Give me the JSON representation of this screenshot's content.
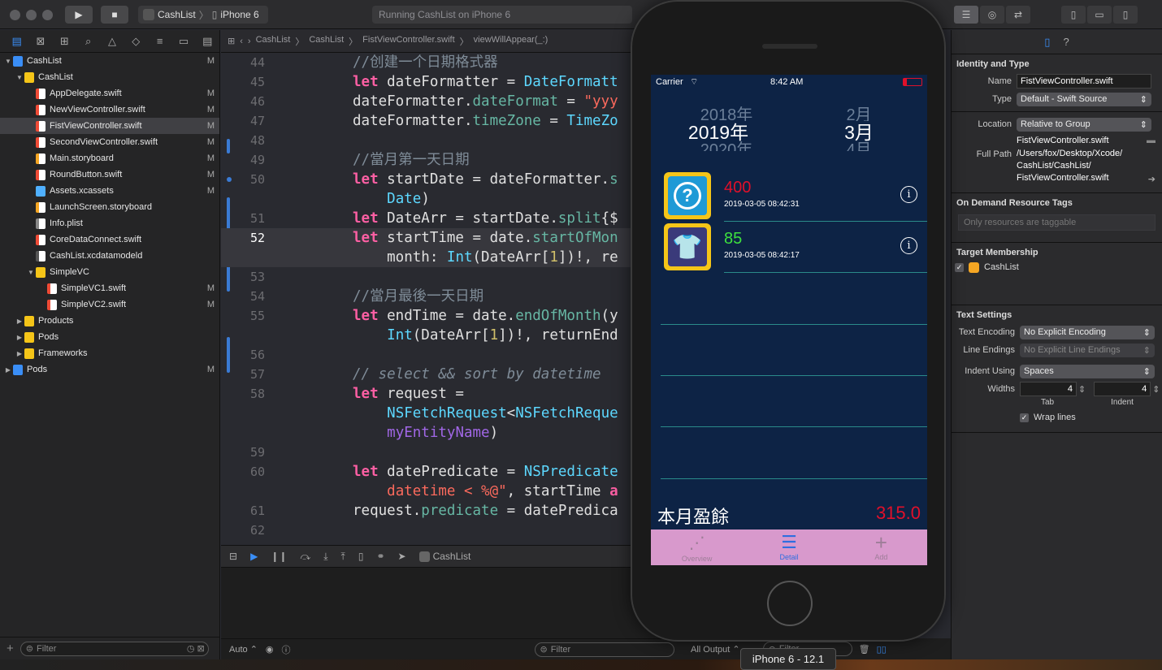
{
  "toolbar": {
    "scheme_project": "CashList",
    "scheme_device": "iPhone 6",
    "status": "Running CashList on iPhone 6"
  },
  "navigator": {
    "tree": [
      {
        "label": "CashList",
        "indent": 0,
        "icon": "project",
        "disclosure": "open",
        "badge": "M"
      },
      {
        "label": "CashList",
        "indent": 1,
        "icon": "folder",
        "disclosure": "open",
        "badge": ""
      },
      {
        "label": "AppDelegate.swift",
        "indent": 2,
        "icon": "swift",
        "disclosure": "",
        "badge": "M"
      },
      {
        "label": "NewViewController.swift",
        "indent": 2,
        "icon": "swift",
        "disclosure": "",
        "badge": "M"
      },
      {
        "label": "FistViewController.swift",
        "indent": 2,
        "icon": "swift",
        "disclosure": "",
        "badge": "M",
        "selected": true
      },
      {
        "label": "SecondViewController.swift",
        "indent": 2,
        "icon": "swift",
        "disclosure": "",
        "badge": "M"
      },
      {
        "label": "Main.storyboard",
        "indent": 2,
        "icon": "storyboard",
        "disclosure": "",
        "badge": "M"
      },
      {
        "label": "RoundButton.swift",
        "indent": 2,
        "icon": "swift",
        "disclosure": "",
        "badge": "M"
      },
      {
        "label": "Assets.xcassets",
        "indent": 2,
        "icon": "assets",
        "disclosure": "",
        "badge": "M"
      },
      {
        "label": "LaunchScreen.storyboard",
        "indent": 2,
        "icon": "storyboard",
        "disclosure": "",
        "badge": ""
      },
      {
        "label": "Info.plist",
        "indent": 2,
        "icon": "plist",
        "disclosure": "",
        "badge": ""
      },
      {
        "label": "CoreDataConnect.swift",
        "indent": 2,
        "icon": "swift",
        "disclosure": "",
        "badge": ""
      },
      {
        "label": "CashList.xcdatamodeld",
        "indent": 2,
        "icon": "model",
        "disclosure": "",
        "badge": ""
      },
      {
        "label": "SimpleVC",
        "indent": 2,
        "icon": "folder",
        "disclosure": "open",
        "badge": ""
      },
      {
        "label": "SimpleVC1.swift",
        "indent": 3,
        "icon": "swift",
        "disclosure": "",
        "badge": "M"
      },
      {
        "label": "SimpleVC2.swift",
        "indent": 3,
        "icon": "swift",
        "disclosure": "",
        "badge": "M"
      },
      {
        "label": "Products",
        "indent": 1,
        "icon": "folder",
        "disclosure": "closed",
        "badge": ""
      },
      {
        "label": "Pods",
        "indent": 1,
        "icon": "folder",
        "disclosure": "closed",
        "badge": ""
      },
      {
        "label": "Frameworks",
        "indent": 1,
        "icon": "folder",
        "disclosure": "closed",
        "badge": ""
      },
      {
        "label": "Pods",
        "indent": 0,
        "icon": "project",
        "disclosure": "closed",
        "badge": "M"
      }
    ],
    "filter_placeholder": "Filter"
  },
  "editor": {
    "breadcrumb": [
      "CashList",
      "CashList",
      "FistViewController.swift",
      "viewWillAppear(_:)"
    ],
    "lines": [
      {
        "n": "44",
        "html": "<span class=\"cm\">//创建一个日期格式器</span>"
      },
      {
        "n": "45",
        "html": "<span class=\"kw\">let</span> dateFormatter = <span class=\"ty\">DateFormatt</span>"
      },
      {
        "n": "46",
        "html": "dateFormatter.<span class=\"fn\">dateFormat</span> = <span class=\"st\">\"yyy</span>"
      },
      {
        "n": "47",
        "html": "dateFormatter.<span class=\"fn\">timeZone</span> = <span class=\"ty\">TimeZo</span>"
      },
      {
        "n": "48",
        "html": ""
      },
      {
        "n": "49",
        "html": "<span class=\"cm\">//當月第一天日期</span>"
      },
      {
        "n": "50",
        "html": "<span class=\"kw\">let</span> startDate = dateFormatter.<span class=\"fn\">s</span>"
      },
      {
        "n": "",
        "html": "    <span class=\"ty\">Date</span>)"
      },
      {
        "n": "51",
        "html": "<span class=\"kw\">let</span> DateArr = startDate.<span class=\"fn\">split</span>{$"
      },
      {
        "n": "52",
        "html": "<span class=\"kw\">let</span> startTime = date.<span class=\"fn\">startOfMon</span>",
        "hl": true
      },
      {
        "n": "",
        "html": "    month: <span class=\"ty\">Int</span>(DateArr[<span class=\"nm\">1</span>])!, re",
        "hl": true
      },
      {
        "n": "53",
        "html": ""
      },
      {
        "n": "54",
        "html": "<span class=\"cm\">//當月最後一天日期</span>"
      },
      {
        "n": "55",
        "html": "<span class=\"kw\">let</span> endTime = date.<span class=\"fn\">endOfMonth</span>(y"
      },
      {
        "n": "",
        "html": "    <span class=\"ty\">Int</span>(DateArr[<span class=\"nm\">1</span>])!, returnEnd"
      },
      {
        "n": "56",
        "html": ""
      },
      {
        "n": "57",
        "html": "<span class=\"cmi\">// select &amp;&amp; sort by datetime</span>"
      },
      {
        "n": "58",
        "html": "<span class=\"kw\">let</span> request ="
      },
      {
        "n": "",
        "html": "    <span class=\"ty\">NSFetchRequest</span>&lt;<span class=\"ty\">NSFetchReque</span>"
      },
      {
        "n": "",
        "html": "    <span class=\"pl\">myEntityName</span>)"
      },
      {
        "n": "59",
        "html": ""
      },
      {
        "n": "60",
        "html": "<span class=\"kw\">let</span> datePredicate = <span class=\"ty\">NSPredicate</span>"
      },
      {
        "n": "",
        "html": "    <span class=\"st\">datetime &lt; %@\"</span>, startTime <span class=\"kw\">a</span>"
      },
      {
        "n": "61",
        "html": "request.<span class=\"fn\">predicate</span> = datePredica"
      },
      {
        "n": "62",
        "html": ""
      }
    ],
    "debug_target": "CashList",
    "console_auto": "Auto",
    "console_filter": "Filter",
    "output_label": "All Output",
    "output_filter": "Filter"
  },
  "inspector": {
    "identity_title": "Identity and Type",
    "name_label": "Name",
    "name_value": "FistViewController.swift",
    "type_label": "Type",
    "type_value": "Default - Swift Source",
    "location_label": "Location",
    "location_value": "Relative to Group",
    "location_file": "FistViewController.swift",
    "fullpath_label": "Full Path",
    "fullpath_value": "/Users/fox/Desktop/Xcode/ CashList/CashList/ FistViewController.swift",
    "odr_title": "On Demand Resource Tags",
    "odr_placeholder": "Only resources are taggable",
    "membership_title": "Target Membership",
    "membership_target": "CashList",
    "text_title": "Text Settings",
    "encoding_label": "Text Encoding",
    "encoding_value": "No Explicit Encoding",
    "endings_label": "Line Endings",
    "endings_value": "No Explicit Line Endings",
    "indent_label": "Indent Using",
    "indent_value": "Spaces",
    "widths_label": "Widths",
    "tab_value": "4",
    "indent_width_value": "4",
    "tab_label": "Tab",
    "indent_sub_label": "Indent",
    "wrap_label": "Wrap lines"
  },
  "simulator": {
    "carrier": "Carrier",
    "time": "8:42 AM",
    "picker": {
      "years": [
        "2018年",
        "2019年",
        "2020年"
      ],
      "months": [
        "2月",
        "3月",
        "4月"
      ]
    },
    "records": [
      {
        "amount": "400",
        "datetime": "2019-03-05 08:42:31",
        "color": "#e0102a",
        "icon": "question-icon"
      },
      {
        "amount": "85",
        "datetime": "2019-03-05 08:42:17",
        "color": "#3ee03e",
        "icon": "tshirt-icon"
      }
    ],
    "summary_label": "本月盈餘",
    "summary_value": "315.0",
    "tabs": [
      {
        "label": "Overview",
        "active": false
      },
      {
        "label": "Detail",
        "active": true
      },
      {
        "label": "Add",
        "active": false
      }
    ],
    "caption": "iPhone 6 - 12.1"
  }
}
